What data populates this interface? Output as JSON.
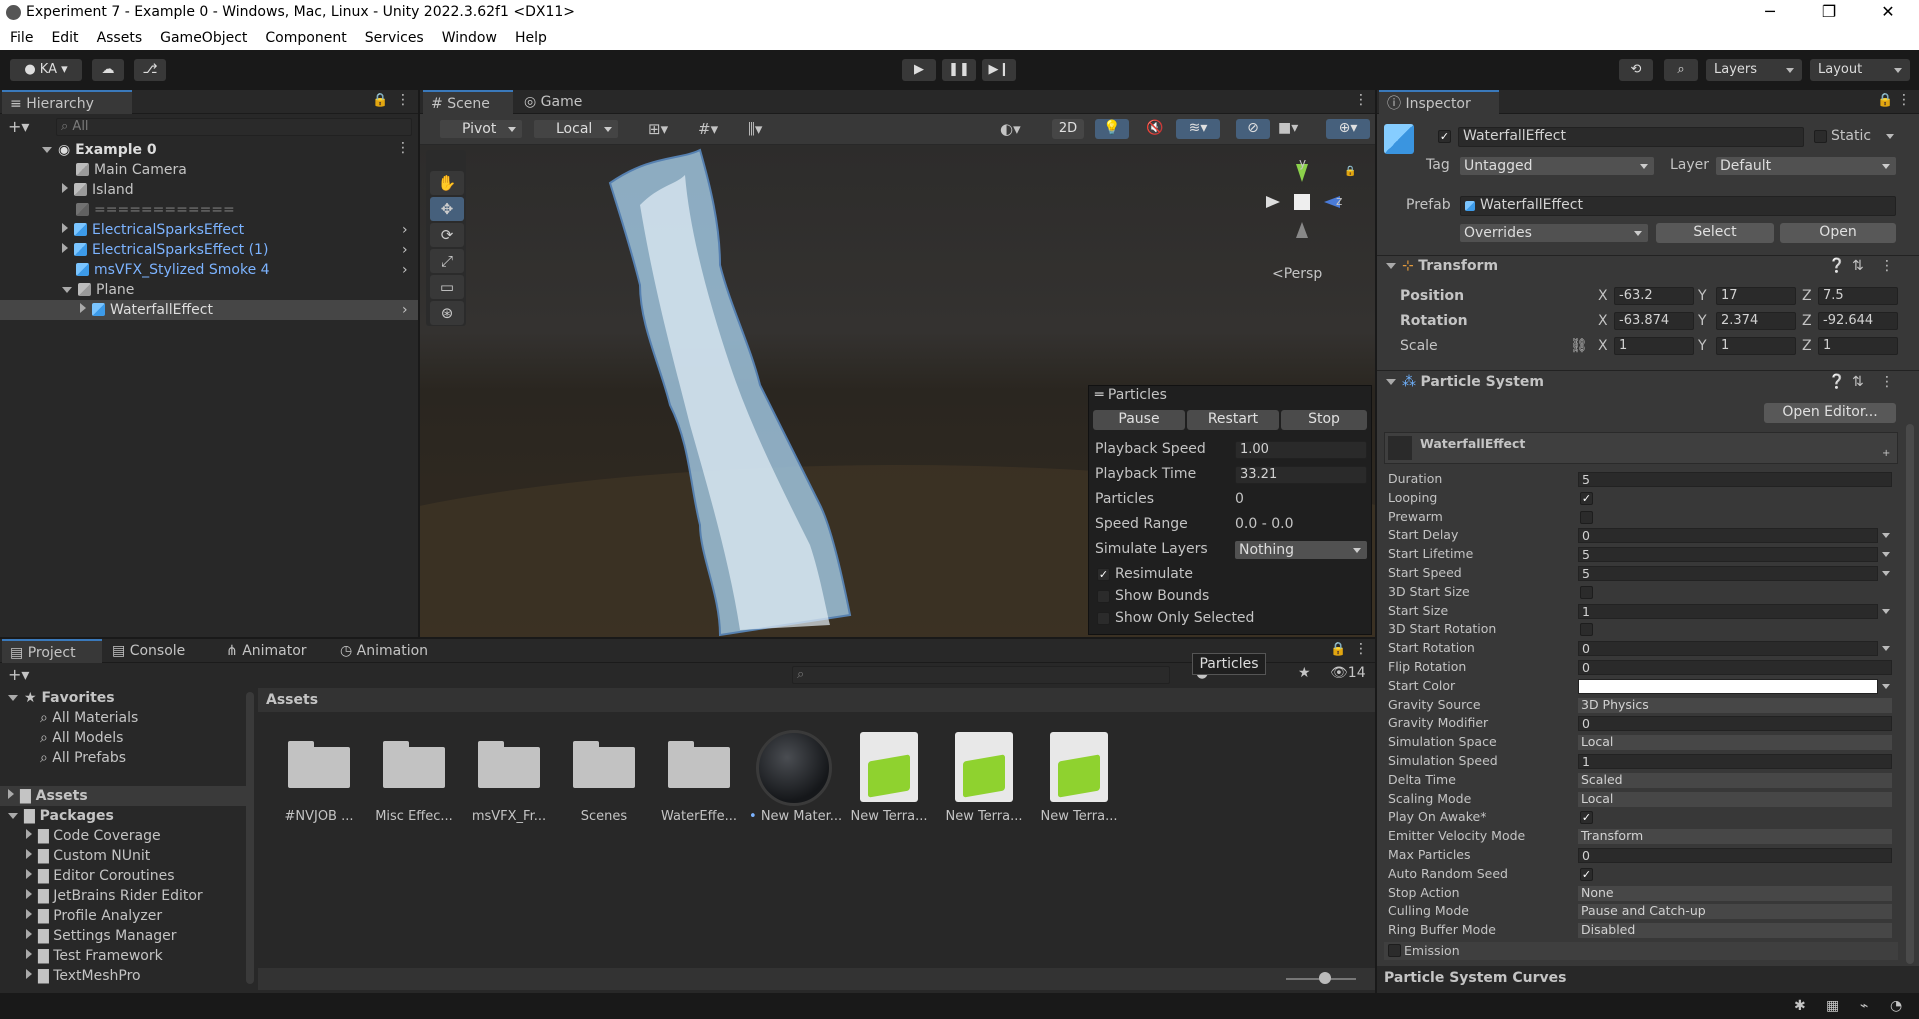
{
  "window": {
    "title": "Experiment 7 - Example 0 - Windows, Mac, Linux - Unity 2022.3.62f1 <DX11>",
    "minimize": "─",
    "restore": "❐",
    "close": "✕"
  },
  "menu": [
    "File",
    "Edit",
    "Assets",
    "GameObject",
    "Component",
    "Services",
    "Window",
    "Help"
  ],
  "toolbar": {
    "account": "KA",
    "layers": "Layers",
    "layout": "Layout"
  },
  "hierarchy": {
    "tab": "Hierarchy",
    "search_placeholder": "All",
    "scene": "Example 0",
    "items": [
      {
        "label": "Main Camera"
      },
      {
        "label": "Island"
      },
      {
        "label": "============"
      },
      {
        "label": "ElectricalSparksEffect"
      },
      {
        "label": "ElectricalSparksEffect (1)"
      },
      {
        "label": "msVFX_Stylized Smoke 4"
      },
      {
        "label": "Plane"
      },
      {
        "label": "WaterfallEffect"
      }
    ]
  },
  "scene_view": {
    "tabs": [
      "Scene",
      "Game"
    ],
    "pivot": "Pivot",
    "local": "Local",
    "mode_2d": "2D",
    "persp": "<Persp",
    "gizmo_y": "y",
    "gizmo_z": "z"
  },
  "particles_overlay": {
    "title": "Particles",
    "buttons": [
      "Pause",
      "Restart",
      "Stop"
    ],
    "rows": [
      {
        "label": "Playback Speed",
        "value": "1.00"
      },
      {
        "label": "Playback Time",
        "value": "33.21"
      },
      {
        "label": "Particles",
        "value": "0"
      },
      {
        "label": "Speed Range",
        "value": "0.0 - 0.0"
      },
      {
        "label": "Simulate Layers",
        "value": "Nothing"
      }
    ],
    "checks": [
      {
        "label": "Resimulate",
        "checked": true
      },
      {
        "label": "Show Bounds",
        "checked": false
      },
      {
        "label": "Show Only Selected",
        "checked": false
      }
    ],
    "tooltip": "Particles"
  },
  "project": {
    "tabs": [
      "Project",
      "Console",
      "Animator",
      "Animation"
    ],
    "hidden_count": "14",
    "favorites_label": "Favorites",
    "favorites": [
      "All Materials",
      "All Models",
      "All Prefabs"
    ],
    "assets_label": "Assets",
    "packages_label": "Packages",
    "packages": [
      "Code Coverage",
      "Custom NUnit",
      "Editor Coroutines",
      "JetBrains Rider Editor",
      "Profile Analyzer",
      "Settings Manager",
      "Test Framework",
      "TextMeshPro"
    ],
    "breadcrumb": "Assets",
    "items": [
      {
        "label": "#NVJOB ...",
        "kind": "folder"
      },
      {
        "label": "Misc Effec...",
        "kind": "folder"
      },
      {
        "label": "msVFX_Fr...",
        "kind": "folder"
      },
      {
        "label": "Scenes",
        "kind": "folder"
      },
      {
        "label": "WaterEffe...",
        "kind": "folder"
      },
      {
        "label": "New Mater...",
        "kind": "material"
      },
      {
        "label": "New Terra...",
        "kind": "terrain"
      },
      {
        "label": "New Terra...",
        "kind": "terrain"
      },
      {
        "label": "New Terra...",
        "kind": "terrain"
      }
    ]
  },
  "inspector": {
    "tab": "Inspector",
    "name": "WaterfallEffect",
    "static": "Static",
    "tag_label": "Tag",
    "tag": "Untagged",
    "layer_label": "Layer",
    "layer": "Default",
    "prefab_label": "Prefab",
    "prefab": "WaterfallEffect",
    "overrides": "Overrides",
    "select": "Select",
    "open": "Open",
    "transform": {
      "title": "Transform",
      "position": {
        "label": "Position",
        "x": "-63.2",
        "y": "17",
        "z": "7.5"
      },
      "rotation": {
        "label": "Rotation",
        "x": "-63.874",
        "y": "2.374",
        "z": "-92.644"
      },
      "scale": {
        "label": "Scale",
        "x": "1",
        "y": "1",
        "z": "1"
      }
    },
    "particle_system": {
      "title": "Particle System",
      "open_editor": "Open Editor...",
      "header": "WaterfallEffect",
      "fields": [
        {
          "label": "Duration",
          "value": "5",
          "kind": "text"
        },
        {
          "label": "Looping",
          "value": "✓",
          "kind": "check"
        },
        {
          "label": "Prewarm",
          "value": "",
          "kind": "check"
        },
        {
          "label": "Start Delay",
          "value": "0",
          "kind": "text"
        },
        {
          "label": "Start Lifetime",
          "value": "5",
          "kind": "text"
        },
        {
          "label": "Start Speed",
          "value": "5",
          "kind": "text"
        },
        {
          "label": "3D Start Size",
          "value": "",
          "kind": "check"
        },
        {
          "label": "Start Size",
          "value": "1",
          "kind": "text"
        },
        {
          "label": "3D Start Rotation",
          "value": "",
          "kind": "check"
        },
        {
          "label": "Start Rotation",
          "value": "0",
          "kind": "text"
        },
        {
          "label": "Flip Rotation",
          "value": "0",
          "kind": "text"
        },
        {
          "label": "Start Color",
          "value": "",
          "kind": "color"
        },
        {
          "label": "Gravity Source",
          "value": "3D Physics",
          "kind": "drop"
        },
        {
          "label": "Gravity Modifier",
          "value": "0",
          "kind": "text"
        },
        {
          "label": "Simulation Space",
          "value": "Local",
          "kind": "drop"
        },
        {
          "label": "Simulation Speed",
          "value": "1",
          "kind": "text"
        },
        {
          "label": "Delta Time",
          "value": "Scaled",
          "kind": "drop"
        },
        {
          "label": "Scaling Mode",
          "value": "Local",
          "kind": "drop"
        },
        {
          "label": "Play On Awake*",
          "value": "✓",
          "kind": "check"
        },
        {
          "label": "Emitter Velocity Mode",
          "value": "Transform",
          "kind": "drop"
        },
        {
          "label": "Max Particles",
          "value": "0",
          "kind": "text"
        },
        {
          "label": "Auto Random Seed",
          "value": "✓",
          "kind": "check"
        },
        {
          "label": "Stop Action",
          "value": "None",
          "kind": "drop"
        },
        {
          "label": "Culling Mode",
          "value": "Pause and Catch-up",
          "kind": "drop"
        },
        {
          "label": "Ring Buffer Mode",
          "value": "Disabled",
          "kind": "drop"
        }
      ],
      "emission": "Emission",
      "curves": "Particle System Curves"
    }
  },
  "colors": {
    "accent": "#3a79bb",
    "prefab_blue": "#7cb3ff",
    "terrain_green": "#8fd22f"
  }
}
